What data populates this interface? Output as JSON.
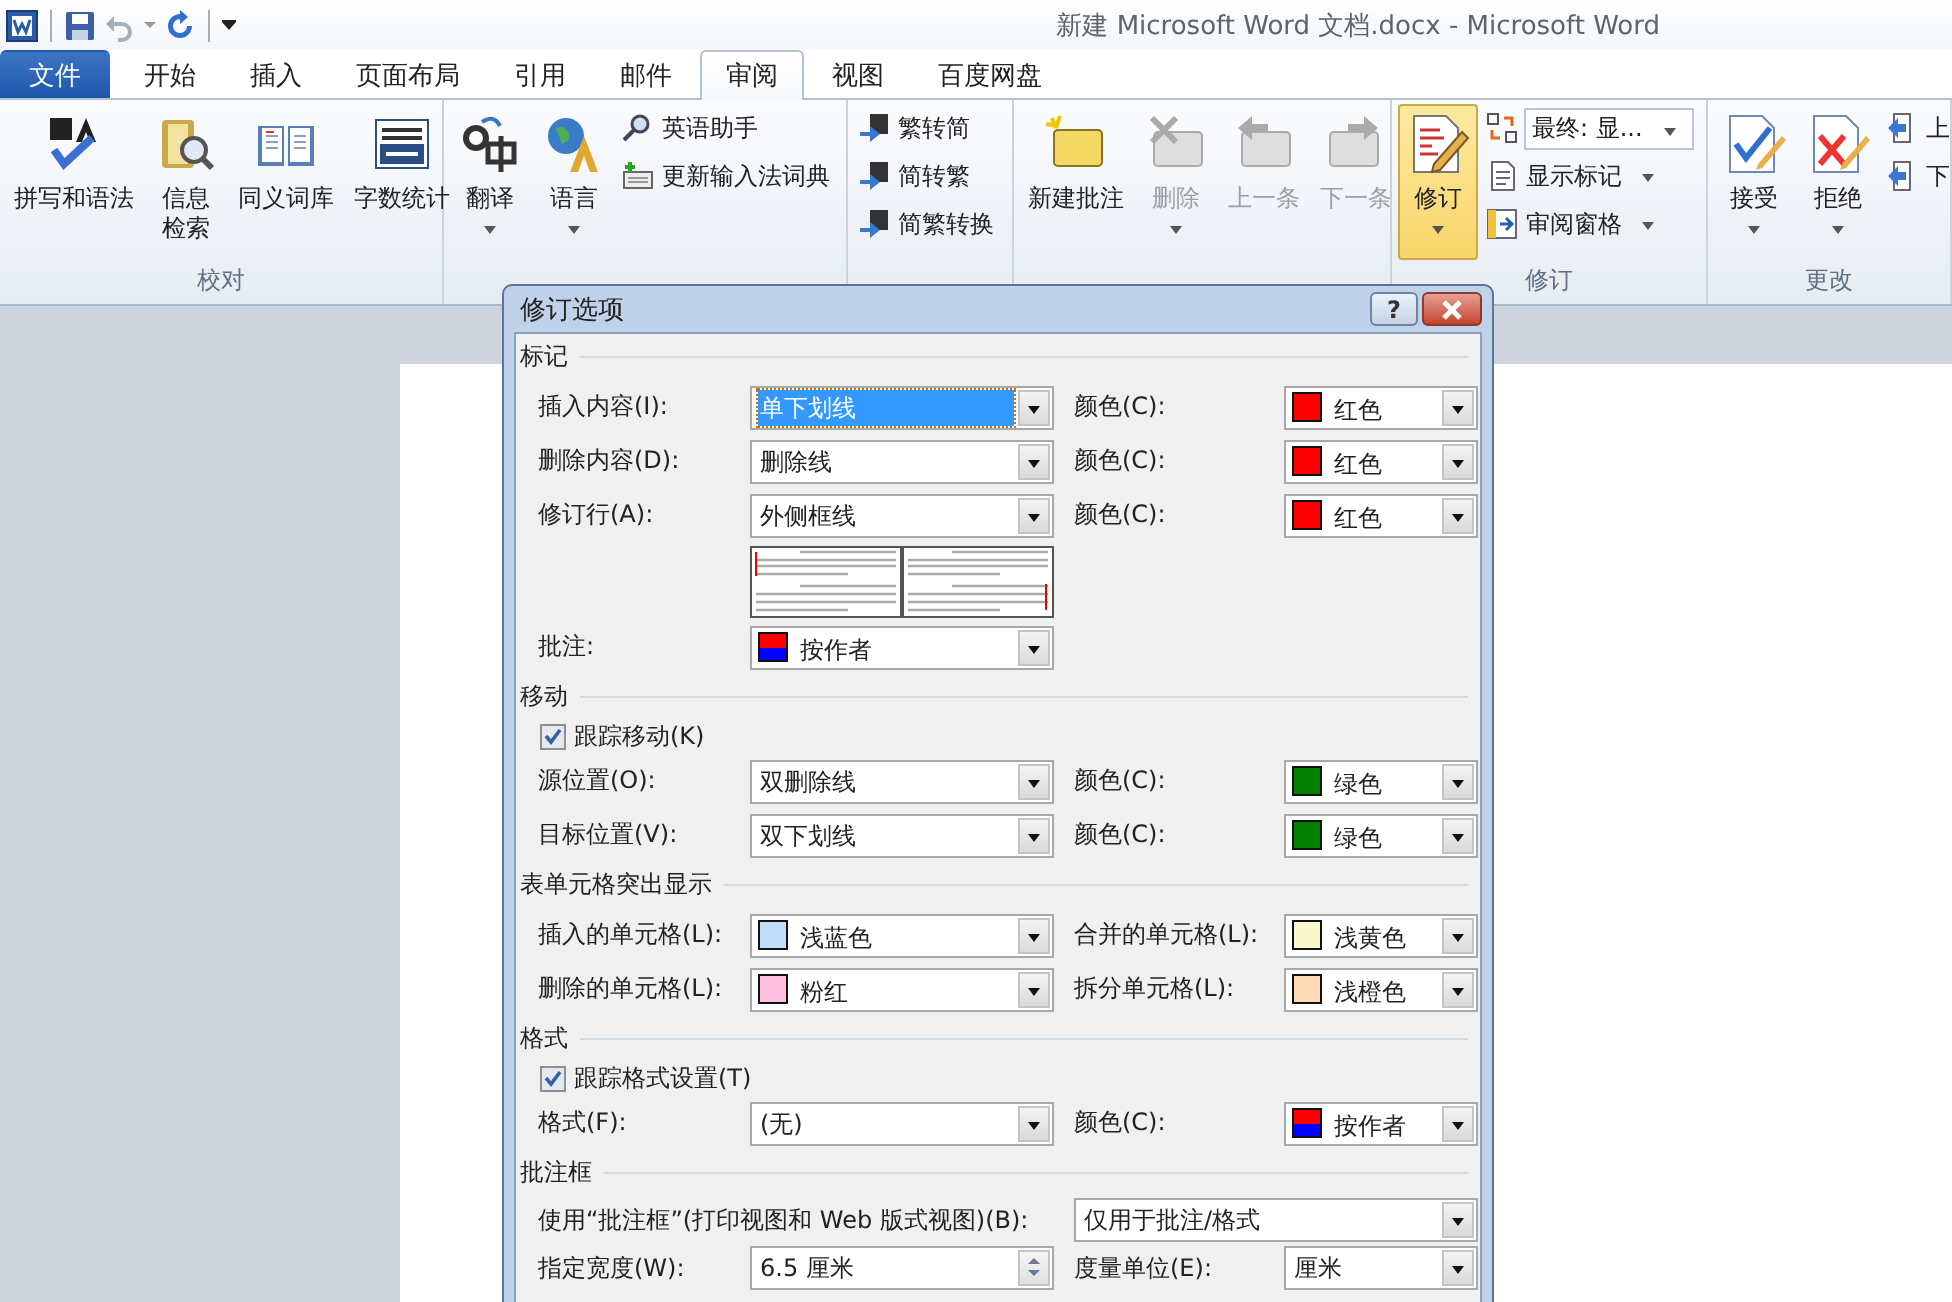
{
  "window": {
    "title": "新建 Microsoft Word 文档.docx  -  Microsoft Word"
  },
  "tabs": [
    {
      "label": "文件",
      "kind": "file",
      "selected": false
    },
    {
      "label": "开始",
      "kind": "tab",
      "selected": false
    },
    {
      "label": "插入",
      "kind": "tab",
      "selected": false
    },
    {
      "label": "页面布局",
      "kind": "tab",
      "selected": false
    },
    {
      "label": "引用",
      "kind": "tab",
      "selected": false
    },
    {
      "label": "邮件",
      "kind": "tab",
      "selected": false
    },
    {
      "label": "审阅",
      "kind": "tab",
      "selected": true
    },
    {
      "label": "视图",
      "kind": "tab",
      "selected": false
    },
    {
      "label": "百度网盘",
      "kind": "tab",
      "selected": false
    }
  ],
  "ribbon_groups": [
    {
      "label": "校对",
      "items": [
        {
          "kind": "large",
          "label": "拼写和语法",
          "dropdown": false
        },
        {
          "kind": "large",
          "label": [
            "信息",
            "检索"
          ],
          "dropdown": false
        },
        {
          "kind": "large",
          "label": "同义词库",
          "dropdown": false
        },
        {
          "kind": "large",
          "label": "字数统计",
          "dropdown": false
        }
      ]
    },
    {
      "items": [
        {
          "kind": "large",
          "label": "翻译",
          "dropdown": true
        },
        {
          "kind": "large",
          "label": "语言",
          "dropdown": true
        },
        {
          "kind": "small",
          "label": "英语助手",
          "dropdown": false
        },
        {
          "kind": "small",
          "label": "更新输入法词典",
          "dropdown": false
        }
      ]
    },
    {
      "items": [
        {
          "kind": "small",
          "label": "繁转简"
        },
        {
          "kind": "small",
          "label": "简转繁"
        },
        {
          "kind": "small",
          "label": "简繁转换"
        }
      ]
    },
    {
      "items": [
        {
          "kind": "large",
          "label": "新建批注",
          "disabled": false,
          "dropdown": false
        },
        {
          "kind": "large",
          "label": "删除",
          "disabled": true,
          "dropdown": true
        },
        {
          "kind": "large",
          "label": "上一条",
          "disabled": true,
          "dropdown": false
        },
        {
          "kind": "large",
          "label": "下一条",
          "disabled": true,
          "dropdown": false
        }
      ]
    },
    {
      "label": "修订",
      "items": [
        {
          "kind": "large",
          "label": "修订",
          "on": true,
          "dropdown": true
        },
        {
          "kind": "select",
          "label": "最终: 显..."
        },
        {
          "kind": "small",
          "label": "显示标记",
          "dropdown": true
        },
        {
          "kind": "small",
          "label": "审阅窗格",
          "dropdown": true
        }
      ]
    },
    {
      "label": "更改",
      "items": [
        {
          "kind": "large",
          "label": "接受",
          "dropdown": true
        },
        {
          "kind": "large",
          "label": "拒绝",
          "dropdown": true
        },
        {
          "kind": "small",
          "label": "上"
        },
        {
          "kind": "small",
          "label": "下"
        }
      ]
    }
  ],
  "dialog": {
    "title": "修订选项",
    "help": "?",
    "sections": [
      {
        "heading": "标记",
        "rows": [
          {
            "kind": "pair",
            "label": "插入内容(I):",
            "field": {
              "value": "单下划线",
              "focused": true
            },
            "label2": "颜色(C):",
            "field2": {
              "value": "红色",
              "color": "#ff0000"
            }
          },
          {
            "kind": "pair",
            "label": "删除内容(D):",
            "field": {
              "value": "删除线",
              "focused": false
            },
            "label2": "颜色(C):",
            "field2": {
              "value": "红色",
              "color": "#ff0000"
            }
          },
          {
            "kind": "pair",
            "label": "修订行(A):",
            "field": {
              "value": "外侧框线",
              "focused": false
            },
            "label2": "颜色(C):",
            "field2": {
              "value": "红色",
              "color": "#ff0000"
            }
          },
          {
            "kind": "preview"
          },
          {
            "kind": "single",
            "label": "批注:",
            "field": {
              "value": "按作者",
              "colors": [
                {
                  "color": "#ff0000"
                },
                {
                  "color": "#0000ff"
                }
              ]
            }
          }
        ]
      },
      {
        "heading": "移动",
        "rows": [
          {
            "kind": "check",
            "label": "跟踪移动(K)",
            "checked": true
          },
          {
            "kind": "pair",
            "label": "源位置(O):",
            "field": {
              "value": "双删除线"
            },
            "label2": "颜色(C):",
            "field2": {
              "value": "绿色",
              "color": "#008000"
            }
          },
          {
            "kind": "pair",
            "label": "目标位置(V):",
            "field": {
              "value": "双下划线"
            },
            "label2": "颜色(C):",
            "field2": {
              "value": "绿色",
              "color": "#008000"
            }
          }
        ]
      },
      {
        "heading": "表单元格突出显示",
        "rows": [
          {
            "kind": "pair",
            "label": "插入的单元格(L):",
            "field": {
              "value": "浅蓝色",
              "color": "#c0ddfa"
            },
            "label2": "合并的单元格(L):",
            "field2": {
              "value": "浅黄色",
              "color": "#f8f8cc"
            }
          },
          {
            "kind": "pair",
            "label": "删除的单元格(L):",
            "field": {
              "value": "粉红",
              "color": "#ffc0e0"
            },
            "label2": "拆分单元格(L):",
            "field2": {
              "value": "浅橙色",
              "color": "#ffdab4"
            }
          }
        ]
      },
      {
        "heading": "格式",
        "rows": [
          {
            "kind": "check",
            "label": "跟踪格式设置(T)",
            "checked": true
          },
          {
            "kind": "pair",
            "label": "格式(F):",
            "field": {
              "value": "(无)"
            },
            "label2": "颜色(C):",
            "field2": {
              "value": "按作者",
              "colors": [
                {
                  "color": "#ff0000"
                },
                {
                  "color": "#0000ff"
                }
              ]
            }
          }
        ]
      },
      {
        "heading": "批注框",
        "rows": [
          {
            "kind": "wide",
            "label": "使用“批注框”(打印视图和 Web 版式视图)(B):",
            "field": {
              "value": "仅用于批注/格式"
            }
          },
          {
            "kind": "spin",
            "label": "指定宽度(W):",
            "field": {
              "value": "6.5 厘米"
            },
            "label2": "度量单位(E):",
            "field2": {
              "value": "厘米"
            }
          }
        ]
      }
    ]
  }
}
